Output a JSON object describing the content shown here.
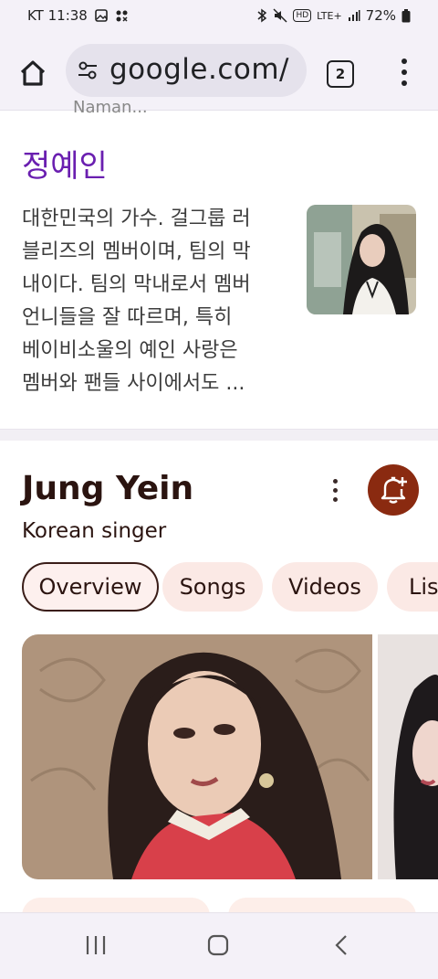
{
  "status_bar": {
    "carrier_time": "KT 11:38",
    "network": "LTE+",
    "battery": "72%"
  },
  "browser": {
    "url": "google.com/",
    "tab_count": "2"
  },
  "knowledge": {
    "cut_off_text": "Naman...",
    "title": "정예인",
    "description_lines": [
      "대한민국의 가수. 걸그룹 러",
      "블리즈의 멤버이며, 팀의 막",
      "내이다. 팀의 막내로서 멤버",
      "언니들을 잘 따르며, 특히",
      "베이비소울의 예인 사랑은",
      "멤버와 팬들 사이에서도 ..."
    ]
  },
  "entity": {
    "name": "Jung Yein",
    "subtitle": "Korean singer",
    "tabs": [
      "Overview",
      "Songs",
      "Videos",
      "Lis"
    ]
  },
  "icons": {
    "home": "home-icon",
    "site_settings": "tune-icon",
    "tabs": "tab-switcher-icon",
    "menu": "more-vert-icon",
    "bell": "bell-add-icon",
    "recents": "recents-icon",
    "home_nav": "home-nav-icon",
    "back": "back-icon"
  },
  "colors": {
    "title_purple": "#6a1fb0",
    "accent_brown": "#8a2a10",
    "chip_bg": "#fbe9e5"
  }
}
